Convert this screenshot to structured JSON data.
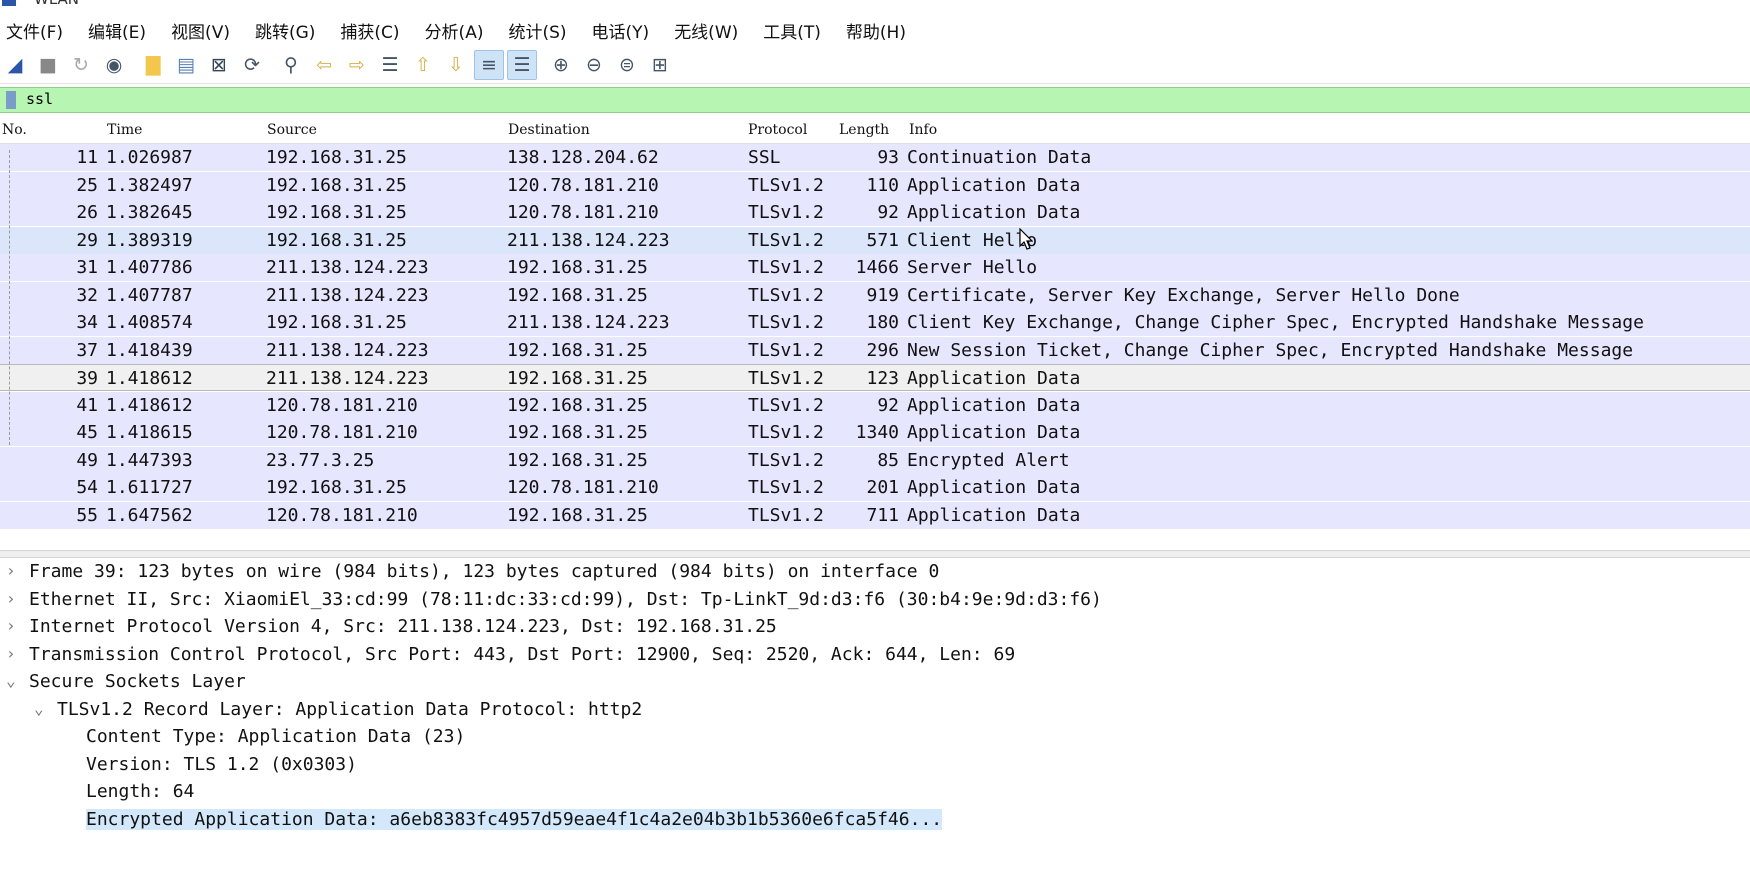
{
  "window": {
    "title": "WLAN"
  },
  "menu": [
    "文件(F)",
    "编辑(E)",
    "视图(V)",
    "跳转(G)",
    "捕获(C)",
    "分析(A)",
    "统计(S)",
    "电话(Y)",
    "无线(W)",
    "工具(T)",
    "帮助(H)"
  ],
  "toolbar": {
    "icons": [
      "shark-fin-start-icon",
      "stop-icon",
      "restart-icon",
      "capture-options-icon",
      "open-file-icon",
      "save-file-icon",
      "close-file-icon",
      "reload-icon",
      "find-icon",
      "go-back-icon",
      "go-forward-icon",
      "go-to-packet-icon",
      "first-packet-icon",
      "last-packet-icon",
      "autoscroll-icon",
      "colorize-icon",
      "zoom-in-icon",
      "zoom-out-icon",
      "zoom-normal-icon",
      "resize-columns-icon"
    ],
    "active": [
      "autoscroll-icon",
      "colorize-icon"
    ]
  },
  "filter": {
    "value": "ssl",
    "bg_color": "#b7f6b2"
  },
  "packet_list": {
    "columns": [
      "No.",
      "Time",
      "Source",
      "Destination",
      "Protocol",
      "Length",
      "Info"
    ],
    "rows": [
      {
        "no": "11",
        "time": "1.026987",
        "src": "192.168.31.25",
        "dst": "138.128.204.62",
        "proto": "SSL",
        "len": "93",
        "info": "Continuation Data"
      },
      {
        "no": "25",
        "time": "1.382497",
        "src": "192.168.31.25",
        "dst": "120.78.181.210",
        "proto": "TLSv1.2",
        "len": "110",
        "info": "Application Data"
      },
      {
        "no": "26",
        "time": "1.382645",
        "src": "192.168.31.25",
        "dst": "120.78.181.210",
        "proto": "TLSv1.2",
        "len": "92",
        "info": "Application Data"
      },
      {
        "no": "29",
        "time": "1.389319",
        "src": "192.168.31.25",
        "dst": "211.138.124.223",
        "proto": "TLSv1.2",
        "len": "571",
        "info": "Client Hello"
      },
      {
        "no": "31",
        "time": "1.407786",
        "src": "211.138.124.223",
        "dst": "192.168.31.25",
        "proto": "TLSv1.2",
        "len": "1466",
        "info": "Server Hello"
      },
      {
        "no": "32",
        "time": "1.407787",
        "src": "211.138.124.223",
        "dst": "192.168.31.25",
        "proto": "TLSv1.2",
        "len": "919",
        "info": "Certificate, Server Key Exchange, Server Hello Done"
      },
      {
        "no": "34",
        "time": "1.408574",
        "src": "192.168.31.25",
        "dst": "211.138.124.223",
        "proto": "TLSv1.2",
        "len": "180",
        "info": "Client Key Exchange, Change Cipher Spec, Encrypted Handshake Message"
      },
      {
        "no": "37",
        "time": "1.418439",
        "src": "211.138.124.223",
        "dst": "192.168.31.25",
        "proto": "TLSv1.2",
        "len": "296",
        "info": "New Session Ticket, Change Cipher Spec, Encrypted Handshake Message"
      },
      {
        "no": "39",
        "time": "1.418612",
        "src": "211.138.124.223",
        "dst": "192.168.31.25",
        "proto": "TLSv1.2",
        "len": "123",
        "info": "Application Data"
      },
      {
        "no": "41",
        "time": "1.418612",
        "src": "120.78.181.210",
        "dst": "192.168.31.25",
        "proto": "TLSv1.2",
        "len": "92",
        "info": "Application Data"
      },
      {
        "no": "45",
        "time": "1.418615",
        "src": "120.78.181.210",
        "dst": "192.168.31.25",
        "proto": "TLSv1.2",
        "len": "1340",
        "info": "Application Data"
      },
      {
        "no": "49",
        "time": "1.447393",
        "src": "23.77.3.25",
        "dst": "192.168.31.25",
        "proto": "TLSv1.2",
        "len": "85",
        "info": "Encrypted Alert"
      },
      {
        "no": "54",
        "time": "1.611727",
        "src": "192.168.31.25",
        "dst": "120.78.181.210",
        "proto": "TLSv1.2",
        "len": "201",
        "info": "Application Data"
      },
      {
        "no": "55",
        "time": "1.647562",
        "src": "120.78.181.210",
        "dst": "192.168.31.25",
        "proto": "TLSv1.2",
        "len": "711",
        "info": "Application Data"
      }
    ],
    "selected_no": "39",
    "hover_no": "29",
    "row_color": "#e7e6ff"
  },
  "details": [
    {
      "level": 0,
      "expanded": false,
      "text": "Frame 39: 123 bytes on wire (984 bits), 123 bytes captured (984 bits) on interface 0"
    },
    {
      "level": 0,
      "expanded": false,
      "text": "Ethernet II, Src: XiaomiEl_33:cd:99 (78:11:dc:33:cd:99), Dst: Tp-LinkT_9d:d3:f6 (30:b4:9e:9d:d3:f6)"
    },
    {
      "level": 0,
      "expanded": false,
      "text": "Internet Protocol Version 4, Src: 211.138.124.223, Dst: 192.168.31.25"
    },
    {
      "level": 0,
      "expanded": false,
      "text": "Transmission Control Protocol, Src Port: 443, Dst Port: 12900, Seq: 2520, Ack: 644, Len: 69"
    },
    {
      "level": 0,
      "expanded": true,
      "text": "Secure Sockets Layer"
    },
    {
      "level": 1,
      "expanded": true,
      "text": "TLSv1.2 Record Layer: Application Data Protocol: http2"
    },
    {
      "level": 2,
      "leaf": true,
      "text": "Content Type: Application Data (23)"
    },
    {
      "level": 2,
      "leaf": true,
      "text": "Version: TLS 1.2 (0x0303)"
    },
    {
      "level": 2,
      "leaf": true,
      "text": "Length: 64"
    },
    {
      "level": 2,
      "leaf": true,
      "highlight": true,
      "text": "Encrypted Application Data: a6eb8383fc4957d59eae4f1c4a2e04b3b1b5360e6fca5f46..."
    }
  ]
}
